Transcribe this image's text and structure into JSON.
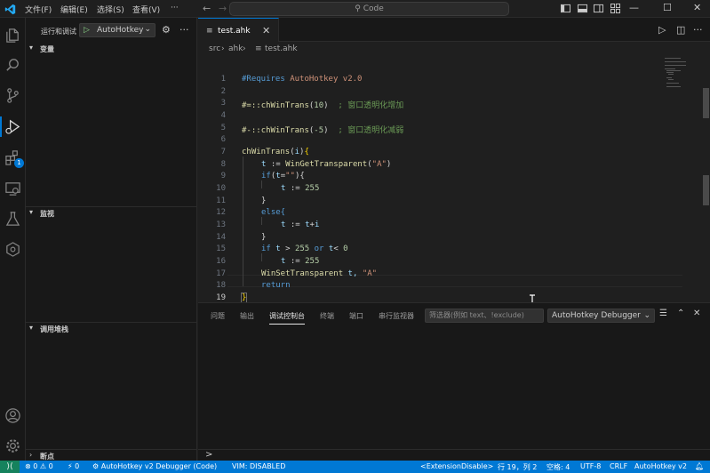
{
  "titlebar": {
    "menus": [
      "文件(F)",
      "编辑(E)",
      "选择(S)",
      "查看(V)",
      "···"
    ],
    "command_center": "Code",
    "icons": [
      "toggle-sidebar-icon",
      "toggle-panel-icon",
      "toggle-secondary-sidebar-icon",
      "layout-icon"
    ],
    "window_controls": [
      "minimize-icon",
      "maximize-icon",
      "close-icon"
    ]
  },
  "activity_bar": {
    "items": [
      "explorer-icon",
      "search-icon",
      "source-control-icon",
      "run-debug-icon",
      "extensions-icon",
      "remote-explorer-icon",
      "testing-icon",
      "gitlens-icon"
    ],
    "extensions_badge": "1",
    "bottom": [
      "account-icon",
      "manage-gear-icon"
    ]
  },
  "sidebar": {
    "title": "运行和调试",
    "config_name": "AutoHotkey",
    "sections": {
      "variables": "变量",
      "watch": "监视",
      "call_stack": "调用堆栈",
      "breakpoints": "断点"
    }
  },
  "editor": {
    "tab_label": "test.ahk",
    "breadcrumb": [
      "src",
      "ahk",
      "test.ahk"
    ],
    "line_numbers": [
      "1",
      "2",
      "3",
      "4",
      "5",
      "6",
      "7",
      "8",
      "9",
      "10",
      "11",
      "12",
      "13",
      "14",
      "15",
      "16",
      "17",
      "18",
      "19"
    ],
    "current_line": "19",
    "lines": {
      "l1a": "#Requires",
      "l1b": " AutoHotkey v2.0",
      "l3a": "#=::",
      "l3b": "chWinTrans",
      "l3c": "(",
      "l3d": "10",
      "l3e": ")",
      "l3f": "  ; 窗口透明化增加",
      "l5a": "#-::",
      "l5b": "chWinTrans",
      "l5c": "(",
      "l5d": "-5",
      "l5e": ")",
      "l5f": "  ; 窗口透明化减弱",
      "l7a": "chWinTrans",
      "l7b": "(",
      "l7c": "i",
      "l7d": ")",
      "l7e": "{",
      "l8a": "t",
      "l8b": " := ",
      "l8c": "WinGetTransparent",
      "l8d": "(",
      "l8e": "\"A\"",
      "l8f": ")",
      "l9a": "if",
      "l9b": "(",
      "l9c": "t",
      "l9d": "=",
      "l9e": "\"\"",
      "l9f": "){",
      "l10a": "t",
      "l10b": " := ",
      "l10c": "255",
      "l11": "}",
      "l12": "else{",
      "l13a": "t",
      "l13b": " := ",
      "l13c": "t",
      "l13d": "+",
      "l13e": "i",
      "l14": "}",
      "l15a": "if",
      "l15b": " t ",
      "l15c": "> ",
      "l15d": "255",
      "l15e": " or ",
      "l15f": "t",
      "l15g": "< ",
      "l15h": "0",
      "l16a": "t",
      "l16b": " := ",
      "l16c": "255",
      "l17a": "WinSetTransparent",
      "l17b": " t, ",
      "l17c": "\"A\"",
      "l18": "return",
      "l19": "}"
    }
  },
  "panel": {
    "tabs": [
      "问题",
      "输出",
      "调试控制台",
      "终端",
      "端口",
      "串行监视器"
    ],
    "active_tab": "调试控制台",
    "filter_placeholder": "筛选器(例如 text、!exclude)",
    "debugger_select": "AutoHotkey Debugger",
    "repl_prompt": ">"
  },
  "statusbar": {
    "remote_icon": "remote-icon",
    "problems": "⊗ 0 ⚠ 0",
    "ports": "⚡ 0",
    "debug_config": "AutoHotkey v2 Debugger (Code)",
    "vim": "VIM: DISABLED",
    "ext_disable": "<ExtensionDisable>",
    "position": "行 19，列 2",
    "spaces": "空格: 4",
    "encoding": "UTF-8",
    "eol": "CRLF",
    "language": "AutoHotkey v2",
    "notifications": "bell-icon"
  }
}
